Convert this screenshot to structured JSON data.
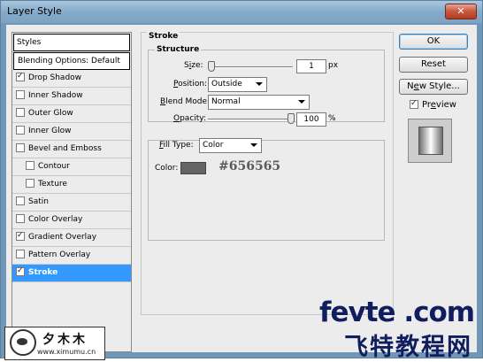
{
  "window": {
    "title": "Layer Style",
    "close": "✕"
  },
  "sidebar": {
    "header": "Styles",
    "items": [
      {
        "label": "Blending Options: Default",
        "checkbox": false,
        "checked": false,
        "sub": false
      },
      {
        "label": "Drop Shadow",
        "checkbox": true,
        "checked": true,
        "sub": false
      },
      {
        "label": "Inner Shadow",
        "checkbox": true,
        "checked": false,
        "sub": false
      },
      {
        "label": "Outer Glow",
        "checkbox": true,
        "checked": false,
        "sub": false
      },
      {
        "label": "Inner Glow",
        "checkbox": true,
        "checked": false,
        "sub": false
      },
      {
        "label": "Bevel and Emboss",
        "checkbox": true,
        "checked": false,
        "sub": false
      },
      {
        "label": "Contour",
        "checkbox": true,
        "checked": false,
        "sub": true
      },
      {
        "label": "Texture",
        "checkbox": true,
        "checked": false,
        "sub": true
      },
      {
        "label": "Satin",
        "checkbox": true,
        "checked": false,
        "sub": false
      },
      {
        "label": "Color Overlay",
        "checkbox": true,
        "checked": false,
        "sub": false
      },
      {
        "label": "Gradient Overlay",
        "checkbox": true,
        "checked": true,
        "sub": false
      },
      {
        "label": "Pattern Overlay",
        "checkbox": true,
        "checked": false,
        "sub": false
      },
      {
        "label": "Stroke",
        "checkbox": true,
        "checked": true,
        "sub": false,
        "selected": true
      }
    ]
  },
  "stroke": {
    "group_title": "Stroke",
    "structure_title": "Structure",
    "size_label": "Size:",
    "size_value": "1",
    "size_unit": "px",
    "position_label": "Position:",
    "position_value": "Outside",
    "blend_mode_label": "Blend Mode:",
    "blend_mode_value": "Normal",
    "opacity_label": "Opacity:",
    "opacity_value": "100",
    "opacity_unit": "%",
    "fill_type_label": "Fill Type:",
    "fill_type_value": "Color",
    "color_label": "Color:",
    "color_hex": "#656565",
    "size_slider_fraction": 0.0,
    "opacity_slider_fraction": 1.0
  },
  "buttons": {
    "ok": "OK",
    "reset": "Reset",
    "new_style": "New Style...",
    "preview_label": "Preview",
    "preview_checked": true
  },
  "watermark": {
    "brand": "fevte .com",
    "brand_cn": "飞特教程网",
    "logo_cn": "夕木木",
    "logo_url": "www.ximumu.cn"
  },
  "colors": {
    "selection": "#3399ff",
    "stroke_color": "#656565",
    "watermark": "#101e60"
  }
}
